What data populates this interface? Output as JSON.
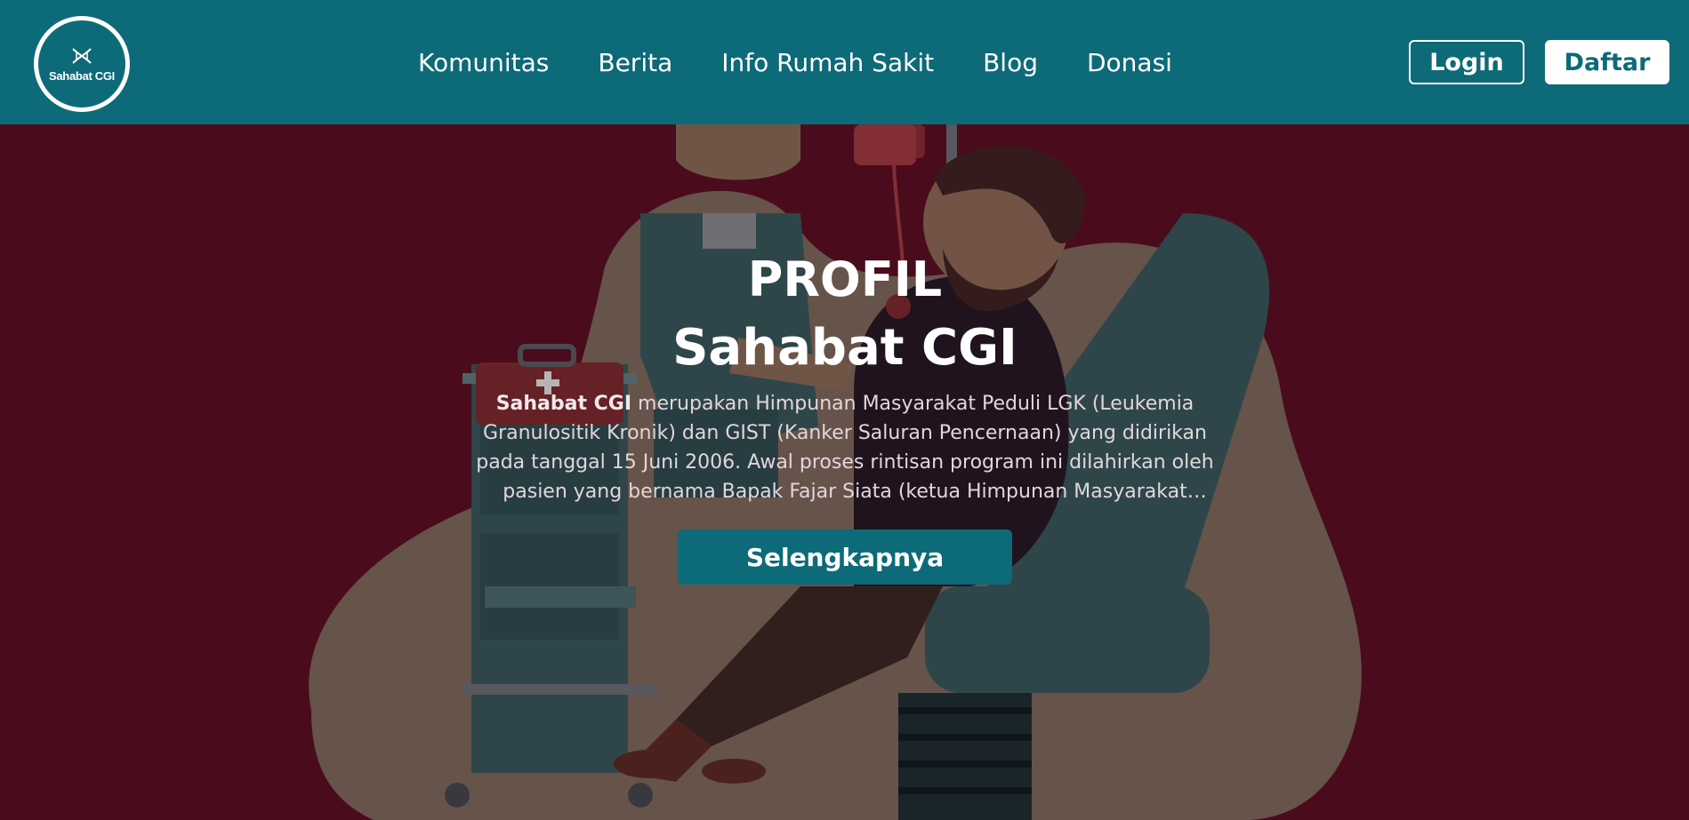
{
  "brand": {
    "logo_text": "Sahabat CGI",
    "logo_icon": "dna-icon"
  },
  "nav": {
    "items": [
      {
        "label": "Komunitas"
      },
      {
        "label": "Berita"
      },
      {
        "label": "Info Rumah Sakit"
      },
      {
        "label": "Blog"
      },
      {
        "label": "Donasi"
      }
    ]
  },
  "auth": {
    "login_label": "Login",
    "register_label": "Daftar"
  },
  "hero": {
    "kicker": "PROFIL",
    "title": "Sahabat CGI",
    "desc_bold": "Sahabat CGI",
    "desc_rest": " merupakan Himpunan Masyarakat Peduli LGK (Leukemia Granulositik Kronik) dan GIST (Kanker Saluran Pencernaan) yang didirikan pada tanggal 15 Juni 2006. Awal proses rintisan program ini dilahirkan oleh pasien yang bernama Bapak Fajar Siata (ketua Himpunan Masyarakat Peduli...",
    "cta_label": "Selengkapnya",
    "illustration": "blood-transfusion-illustration"
  },
  "colors": {
    "primary": "#0d6a78",
    "hero_bg": "#5a0f22",
    "text_light": "#ffffff"
  }
}
